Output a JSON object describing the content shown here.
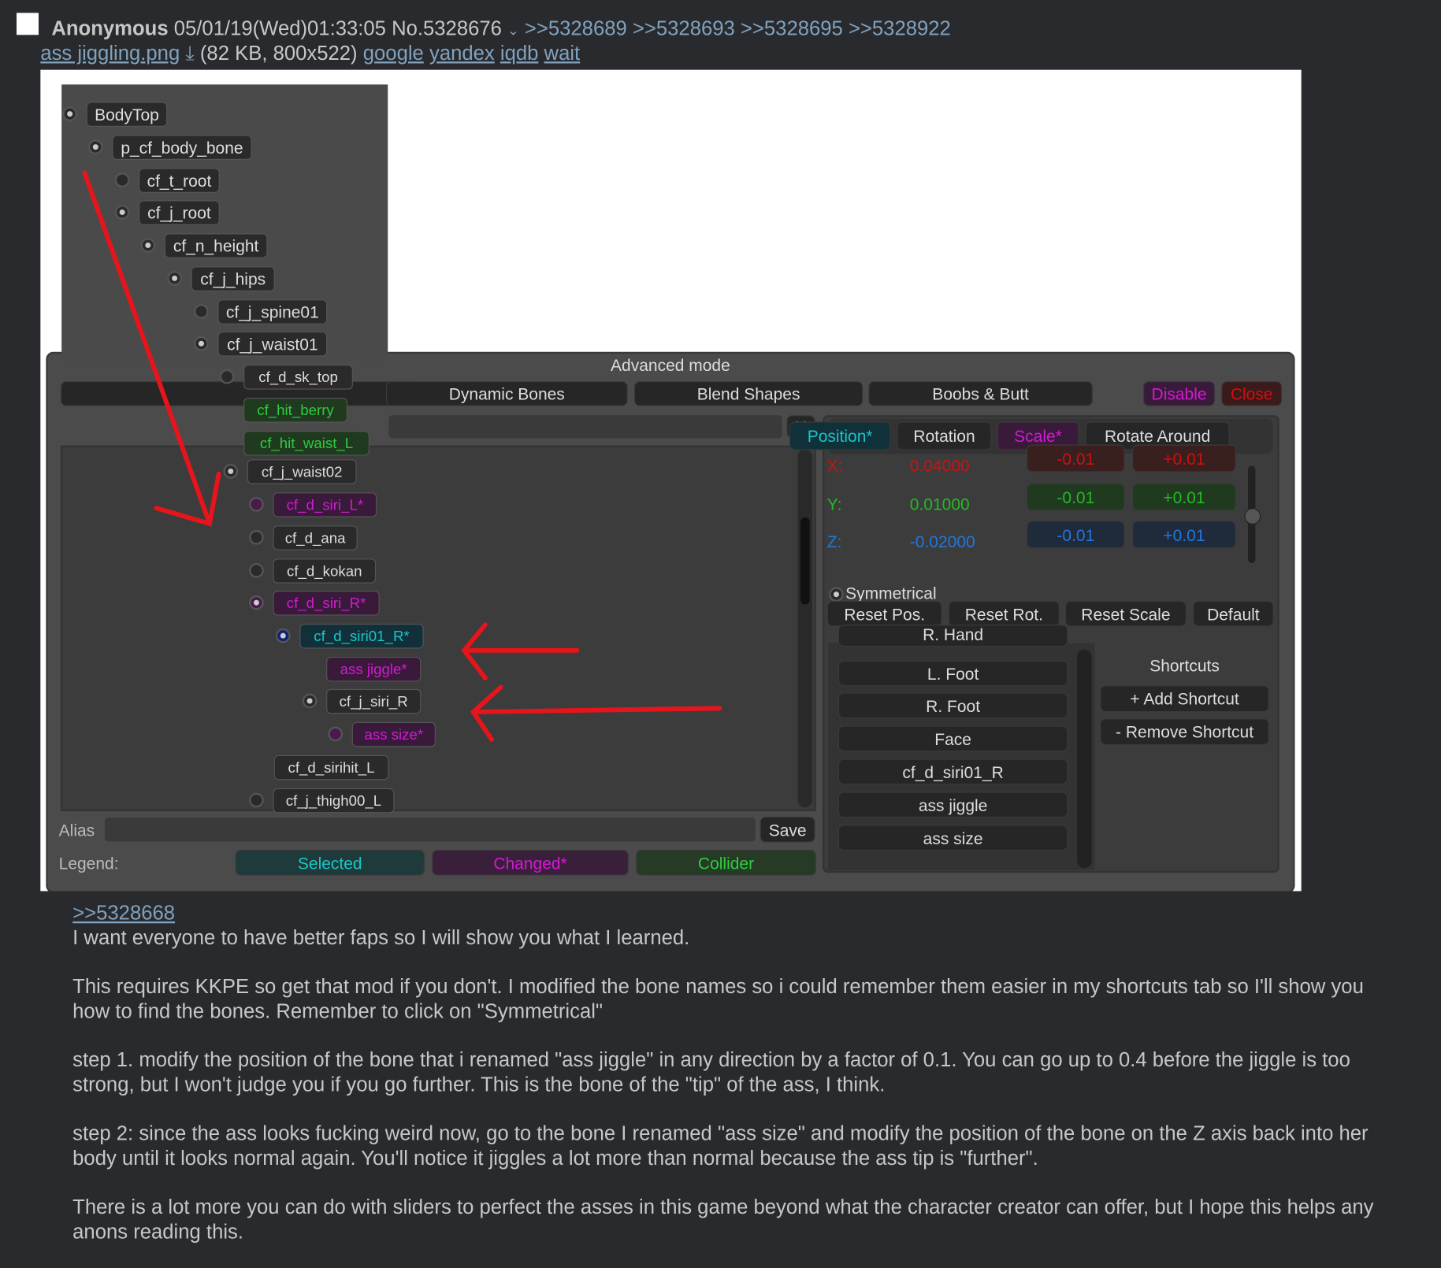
{
  "post": {
    "name": "Anonymous",
    "datetime": "05/01/19(Wed)01:33:05",
    "number": "No.5328676",
    "menu_icon": "chevron-down-icon",
    "replies": [
      ">>5328689",
      ">>5328693",
      ">>5328695",
      ">>5328922"
    ],
    "file_name": "ass jiggling.png",
    "download_icon": "download-icon",
    "file_info": "(82 KB, 800x522)",
    "search_links": [
      "google",
      "yandex",
      "iqdb",
      "wait"
    ],
    "quote": ">>5328668",
    "paragraphs": [
      "I want everyone to have better faps so I will show you what I learned.",
      "This requires KKPE so get that mod if you don't. I modified the bone names so i could remember them easier in my shortcuts tab so I'll show you how to find the bones. Remember to click on \"Symmetrical\"",
      "step 1. modify the position of the bone that i renamed \"ass jiggle\" in any direction by a factor of 0.1. You can go up to 0.4 before the jiggle is too strong, but I won't judge you if you go further. This is the bone of the \"tip\" of the ass, I think.",
      "step 2: since the ass looks fucking weird now, go to the bone I renamed \"ass size\" and modify the position of the bone on the Z axis back into her body until it looks normal again. You'll notice it jiggles a lot more than normal because the ass tip is \"further\".",
      "There is a lot more you can do with sliders to perfect the asses in this game beyond what the character creator can offer, but I hope this helps any anons reading this."
    ]
  },
  "colors": {
    "bg": "#282a2e",
    "link": "#81a2be",
    "selected": "#19c6c6",
    "changed": "#d21ad2",
    "collider": "#2ecc40",
    "x": "#cc1111",
    "y": "#22bb22",
    "z": "#2277dd"
  },
  "tree": [
    {
      "label": "BodyTop",
      "state": "normal",
      "bullet": "on"
    },
    {
      "label": "p_cf_body_bone",
      "state": "normal",
      "bullet": "on"
    },
    {
      "label": "cf_t_root",
      "state": "normal",
      "bullet": "off"
    },
    {
      "label": "cf_j_root",
      "state": "normal",
      "bullet": "on"
    },
    {
      "label": "cf_n_height",
      "state": "normal",
      "bullet": "on"
    },
    {
      "label": "cf_j_hips",
      "state": "normal",
      "bullet": "on"
    },
    {
      "label": "cf_j_spine01",
      "state": "normal",
      "bullet": "off"
    },
    {
      "label": "cf_j_waist01",
      "state": "normal",
      "bullet": "on"
    },
    {
      "label": "cf_d_sk_top",
      "state": "normal",
      "bullet": "off"
    },
    {
      "label": "cf_hit_berry",
      "state": "collider",
      "bullet": "none"
    },
    {
      "label": "cf_hit_waist_L",
      "state": "collider",
      "bullet": "none"
    },
    {
      "label": "cf_j_waist02",
      "state": "normal",
      "bullet": "on"
    },
    {
      "label": "cf_d_siri_L*",
      "state": "changed",
      "bullet": "off"
    },
    {
      "label": "cf_d_ana",
      "state": "normal",
      "bullet": "off"
    },
    {
      "label": "cf_d_kokan",
      "state": "normal",
      "bullet": "off"
    },
    {
      "label": "cf_d_siri_R*",
      "state": "changed",
      "bullet": "on"
    },
    {
      "label": "cf_d_siri01_R*",
      "state": "selected",
      "bullet": "on"
    },
    {
      "label": "ass jiggle*",
      "state": "changed",
      "bullet": "none"
    },
    {
      "label": "cf_j_siri_R",
      "state": "normal",
      "bullet": "on"
    },
    {
      "label": "ass size*",
      "state": "changed",
      "bullet": "off"
    },
    {
      "label": "cf_d_sirihit_L",
      "state": "normal",
      "bullet": "none"
    },
    {
      "label": "cf_j_thigh00_L",
      "state": "normal",
      "bullet": "off"
    }
  ],
  "window": {
    "title": "Advanced mode",
    "tabs": [
      "Dynamic Bones",
      "Blend Shapes",
      "Boobs & Butt"
    ],
    "disable": "Disable",
    "close": "Close",
    "search_clear": "X",
    "subtabs": [
      "Position*",
      "Rotation",
      "Scale*",
      "Rotate Around"
    ],
    "axes": [
      {
        "label": "X:",
        "value": "0.04000",
        "minus": "-0.01",
        "plus": "+0.01"
      },
      {
        "label": "Y:",
        "value": "0.01000",
        "minus": "-0.01",
        "plus": "+0.01"
      },
      {
        "label": "Z:",
        "value": "-0.02000",
        "minus": "-0.01",
        "plus": "+0.01"
      }
    ],
    "symmetrical": "Symmetrical",
    "resets": [
      "Reset Pos.",
      "Reset Rot.",
      "Reset Scale",
      "Default"
    ],
    "shortcuts": [
      "R. Hand",
      "L. Foot",
      "R. Foot",
      "Face",
      "cf_d_siri01_R",
      "ass jiggle",
      "ass size"
    ],
    "shortcuts_title": "Shortcuts",
    "add_shortcut": "+ Add Shortcut",
    "remove_shortcut": "- Remove Shortcut",
    "alias_label": "Alias",
    "alias_value": "",
    "save": "Save",
    "legend_label": "Legend:",
    "legend": [
      "Selected",
      "Changed*",
      "Collider"
    ]
  }
}
